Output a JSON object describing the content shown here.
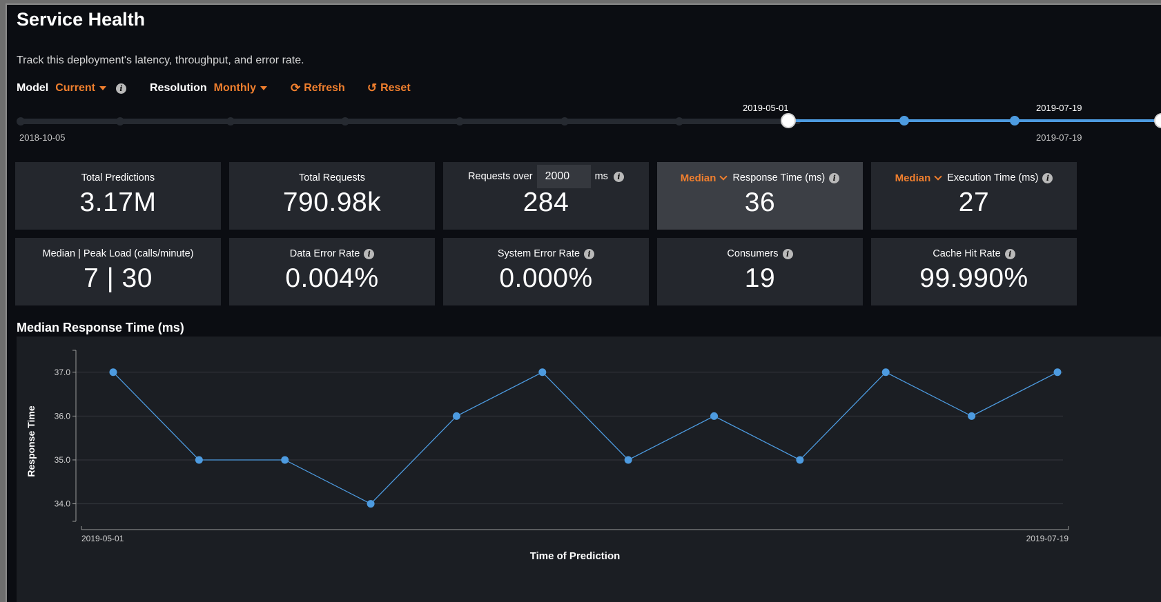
{
  "page": {
    "title": "Service Health",
    "subtitle": "Track this deployment's latency, throughput, and error rate."
  },
  "controls": {
    "model_label": "Model",
    "model_value": "Current",
    "resolution_label": "Resolution",
    "resolution_value": "Monthly",
    "refresh_label": "Refresh",
    "reset_label": "Reset"
  },
  "slider": {
    "range_start": "2018-10-05",
    "selected_start": "2019-05-01",
    "selected_end": "2019-07-19",
    "range_end": "2019-07-19"
  },
  "metrics": {
    "total_predictions": {
      "title": "Total Predictions",
      "value": "3.17M"
    },
    "total_requests": {
      "title": "Total Requests",
      "value": "790.98k"
    },
    "requests_over": {
      "title_prefix": "Requests over",
      "threshold": "2000",
      "unit": "ms",
      "value": "284"
    },
    "response_time": {
      "aggregate": "Median",
      "title": "Response Time (ms)",
      "value": "36"
    },
    "execution_time": {
      "aggregate": "Median",
      "title": "Execution Time (ms)",
      "value": "27"
    },
    "peak_load": {
      "title": "Median | Peak Load (calls/minute)",
      "value": "7 | 30"
    },
    "data_error_rate": {
      "title": "Data Error Rate",
      "value": "0.004%"
    },
    "system_error_rate": {
      "title": "System Error Rate",
      "value": "0.000%"
    },
    "consumers": {
      "title": "Consumers",
      "value": "19"
    },
    "cache_hit_rate": {
      "title": "Cache Hit Rate",
      "value": "99.990%"
    }
  },
  "chart_data": {
    "type": "line",
    "title": "Median Response Time (ms)",
    "xlabel": "Time of Prediction",
    "ylabel": "Response Time",
    "x_tick_labels": [
      "2019-05-01",
      "2019-07-19"
    ],
    "y_ticks": [
      34.0,
      35.0,
      36.0,
      37.0
    ],
    "y_tick_labels": [
      "34.0",
      "35.0",
      "36.0",
      "37.0"
    ],
    "ylim": [
      33.6,
      37.5
    ],
    "grid": true,
    "values": [
      37,
      35,
      35,
      34,
      36,
      37,
      35,
      36,
      35,
      37,
      36,
      37
    ],
    "line_color": "#4d9be0"
  },
  "colors": {
    "accent": "#f07f2e",
    "series": "#4d9be0",
    "card": "#24272d",
    "card_highlight": "#3c3f45"
  }
}
